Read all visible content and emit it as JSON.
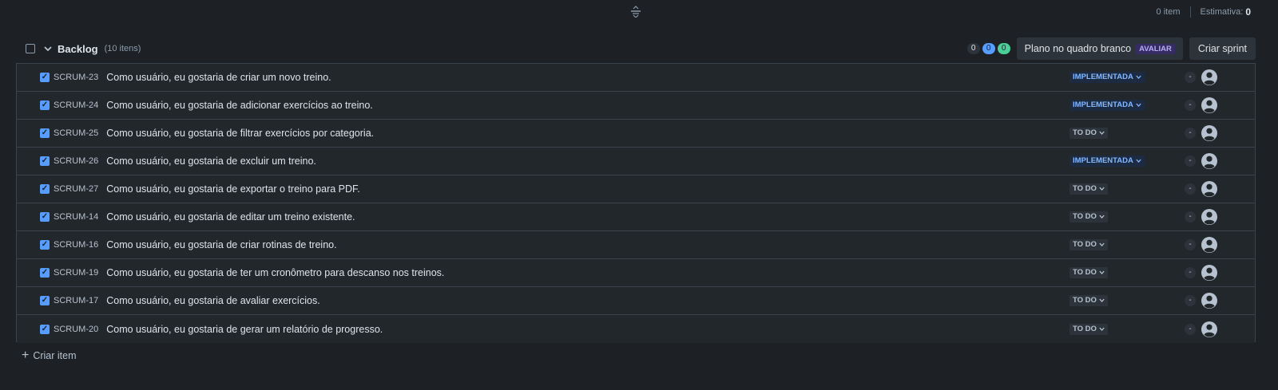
{
  "top": {
    "item_count": "0 item",
    "estimate_label": "Estimativa:",
    "estimate_value": "0"
  },
  "backlog": {
    "title": "Backlog",
    "count": "(10 itens)",
    "pill_gray": "0",
    "pill_blue": "0",
    "pill_green": "0",
    "plan_label": "Plano no quadro branco",
    "plan_lozenge": "AVALIAR",
    "create_sprint": "Criar sprint"
  },
  "issues": [
    {
      "key": "SCRUM-23",
      "summary": "Como usuário, eu gostaria de criar um novo treino.",
      "status": "IMPLEMENTADA",
      "estimate": "-"
    },
    {
      "key": "SCRUM-24",
      "summary": "Como usuário, eu gostaria de adicionar exercícios ao treino.",
      "status": "IMPLEMENTADA",
      "estimate": "-"
    },
    {
      "key": "SCRUM-25",
      "summary": "Como usuário, eu gostaria de filtrar exercícios por categoria.",
      "status": "TO DO",
      "estimate": "-"
    },
    {
      "key": "SCRUM-26",
      "summary": "Como usuário, eu gostaria de excluir um treino.",
      "status": "IMPLEMENTADA",
      "estimate": "-"
    },
    {
      "key": "SCRUM-27",
      "summary": "Como usuário, eu gostaria de exportar o treino para PDF.",
      "status": "TO DO",
      "estimate": "-"
    },
    {
      "key": "SCRUM-14",
      "summary": "Como usuário, eu gostaria de editar um treino existente.",
      "status": "TO DO",
      "estimate": "-"
    },
    {
      "key": "SCRUM-16",
      "summary": "Como usuário, eu gostaria de criar rotinas de treino.",
      "status": "TO DO",
      "estimate": "-"
    },
    {
      "key": "SCRUM-19",
      "summary": "Como usuário, eu gostaria de ter um cronômetro para descanso nos treinos.",
      "status": "TO DO",
      "estimate": "-"
    },
    {
      "key": "SCRUM-17",
      "summary": "Como usuário, eu gostaria de avaliar exercícios.",
      "status": "TO DO",
      "estimate": "-"
    },
    {
      "key": "SCRUM-20",
      "summary": "Como usuário, eu gostaria de gerar um relatório de progresso.",
      "status": "TO DO",
      "estimate": "-"
    }
  ],
  "create_item": "Criar item",
  "icons": {
    "drag": "drag-handle-icon",
    "chevron": "chevron-down-icon",
    "checkbox": "checkbox-icon",
    "avatar": "user-avatar-icon",
    "plus": "plus-icon"
  },
  "colors": {
    "background": "#1d2125",
    "row": "#22272b",
    "checkbox": "#579dff",
    "status_impl_text": "#85b8ff",
    "status_impl_bg": "#1c2b41"
  }
}
